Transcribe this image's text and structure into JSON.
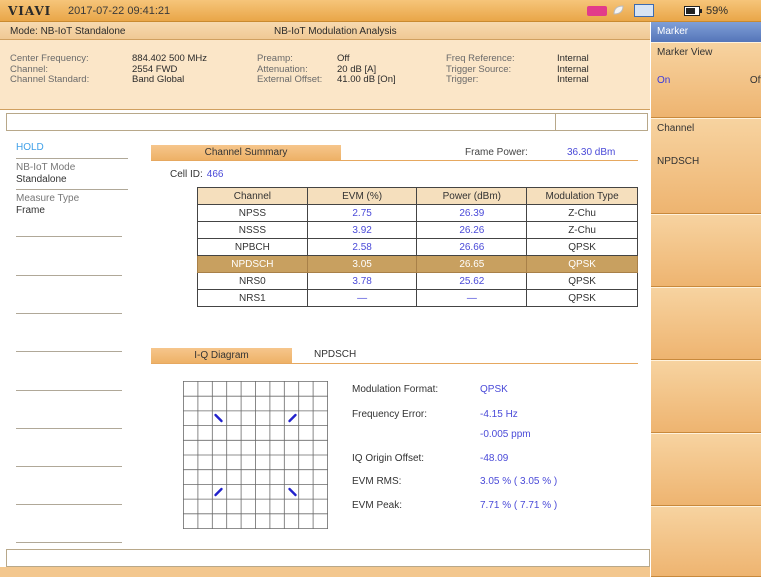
{
  "status_bar": {
    "brand": "VIAVI",
    "datetime": "2017-07-22  09:41:21",
    "battery": "59%"
  },
  "mode_bar": {
    "mode": "Mode: NB-IoT Standalone",
    "title": "NB-IoT Modulation Analysis"
  },
  "settings": {
    "col1": [
      {
        "label": "Center Frequency:",
        "value": "884.402 500 MHz"
      },
      {
        "label": "Channel:",
        "value": "2554 FWD"
      },
      {
        "label": "Channel Standard:",
        "value": "Band Global"
      }
    ],
    "col2": [
      {
        "label": "Preamp:",
        "value": "Off"
      },
      {
        "label": "Attenuation:",
        "value": "20 dB [A]"
      },
      {
        "label": "External Offset:",
        "value": "41.00 dB [On]"
      }
    ],
    "col3": [
      {
        "label": "Freq Reference:",
        "value": "Internal"
      },
      {
        "label": "Trigger Source:",
        "value": "Internal"
      },
      {
        "label": "Trigger:",
        "value": "Internal"
      }
    ]
  },
  "left_panel": {
    "hold": "HOLD",
    "items": [
      {
        "label": "NB-IoT Mode",
        "value": "Standalone"
      },
      {
        "label": "Measure Type",
        "value": "Frame"
      }
    ]
  },
  "summary": {
    "tab": "Channel Summary",
    "frame_power_label": "Frame Power:",
    "frame_power_value": "36.30 dBm",
    "cell_id_label": "Cell ID:",
    "cell_id_value": "466",
    "columns": [
      "Channel",
      "EVM (%)",
      "Power (dBm)",
      "Modulation Type"
    ],
    "rows": [
      [
        "NPSS",
        "2.75",
        "26.39",
        "Z-Chu"
      ],
      [
        "NSSS",
        "3.92",
        "26.26",
        "Z-Chu"
      ],
      [
        "NPBCH",
        "2.58",
        "26.66",
        "QPSK"
      ],
      [
        "NPDSCH",
        "3.05",
        "26.65",
        "QPSK"
      ],
      [
        "NRS0",
        "3.78",
        "25.62",
        "QPSK"
      ],
      [
        "NRS1",
        "—",
        "—",
        "QPSK"
      ]
    ],
    "selected_row": 3
  },
  "iq": {
    "tab": "I-Q Diagram",
    "tab2": "NPDSCH",
    "constellation_points": [
      {
        "i": -1,
        "q": 1
      },
      {
        "i": 1,
        "q": 1
      },
      {
        "i": -1,
        "q": -1
      },
      {
        "i": 1,
        "q": -1
      }
    ],
    "info": [
      {
        "label": "Modulation Format:",
        "value": "QPSK"
      },
      {
        "label": "Frequency Error:",
        "value": "-4.15 Hz"
      },
      {
        "label": "",
        "value": "-0.005 ppm"
      },
      {
        "label": "IQ Origin Offset:",
        "value": "-48.09"
      },
      {
        "label": "EVM RMS:",
        "value": "3.05 % ( 3.05 % )"
      },
      {
        "label": "EVM Peak:",
        "value": "7.71 % ( 7.71 % )"
      }
    ]
  },
  "right_panel": {
    "header": "Marker",
    "marker_view": "Marker View",
    "on": "On",
    "off": "Off",
    "channel_label": "Channel",
    "channel_value": "NPDSCH"
  }
}
